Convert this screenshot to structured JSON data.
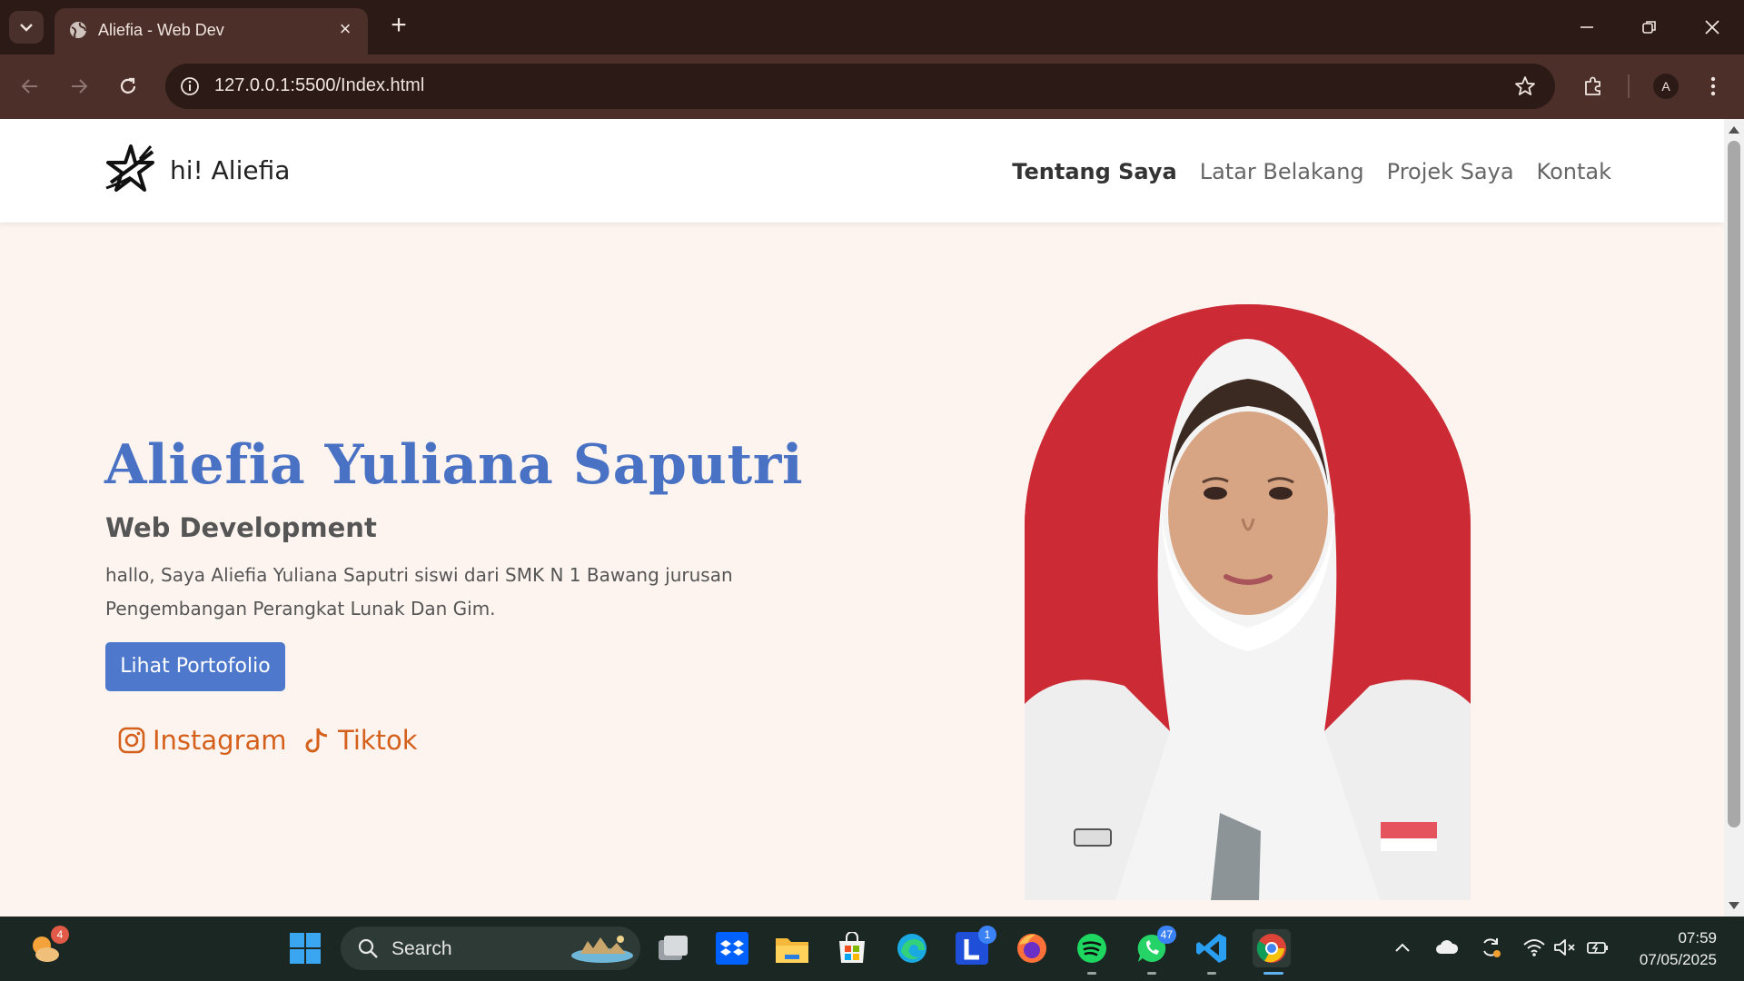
{
  "browser": {
    "tab_title": "Aliefia - Web Dev",
    "url": "127.0.0.1:5500/Index.html",
    "profile_initial": "A"
  },
  "site": {
    "brand": "hi! Aliefia",
    "nav": [
      "Tentang Saya",
      "Latar Belakang",
      "Projek Saya",
      "Kontak"
    ],
    "active_nav": "Tentang Saya",
    "hero": {
      "name": "Aliefia Yuliana Saputri",
      "role": "Web Development",
      "description": "hallo, Saya Aliefia Yuliana Saputri siswi dari SMK N 1 Bawang jurusan Pengembangan Perangkat Lunak Dan Gim.",
      "cta_label": "Lihat Portofolio"
    },
    "social": [
      {
        "label": "Instagram",
        "icon": "instagram-icon"
      },
      {
        "label": "Tiktok",
        "icon": "tiktok-icon"
      }
    ],
    "colors": {
      "accent_blue": "#4a72c4",
      "button_blue": "#4e78cc",
      "social_orange": "#d4601c",
      "page_bg": "#fdf4ef",
      "photo_bg": "#cc2b35"
    }
  },
  "taskbar": {
    "search_label": "Search",
    "weather_badge": "4",
    "mail_badge": "1",
    "whatsapp_badge": "47",
    "time": "07:59",
    "date": "07/05/2025",
    "pinned": [
      "start-icon",
      "task-view-icon",
      "dropbox-icon",
      "file-explorer-icon",
      "microsoft-store-icon",
      "edge-icon",
      "launcher-icon",
      "firefox-icon",
      "spotify-icon",
      "whatsapp-icon",
      "vscode-icon",
      "chrome-icon"
    ]
  }
}
